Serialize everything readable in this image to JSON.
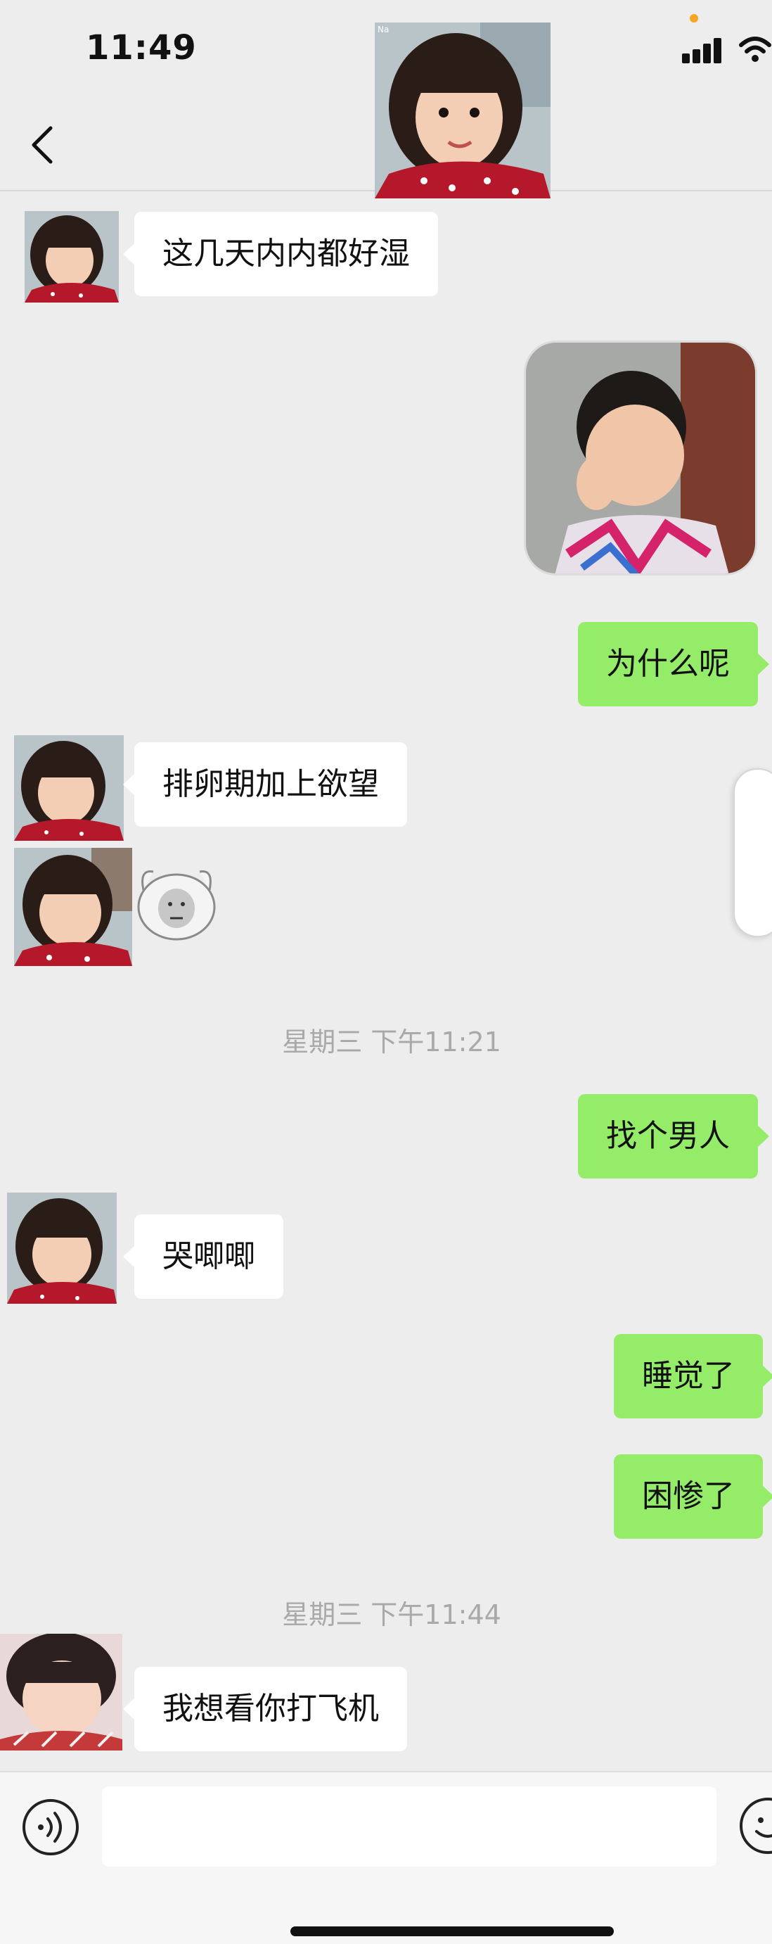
{
  "status_bar": {
    "time": "11:49",
    "signal_icon": "cellular-signal-icon",
    "wifi_icon": "wifi-icon"
  },
  "header": {
    "back_icon": "chevron-left-icon",
    "avatar_overlay_text": "Na"
  },
  "messages": [
    {
      "side": "in",
      "text": "这几天内内都好湿"
    },
    {
      "side": "out",
      "type": "image",
      "description_icon": "photo-message"
    },
    {
      "side": "out",
      "text": "为什么呢"
    },
    {
      "side": "in",
      "text": "排卵期加上欲望"
    },
    {
      "side": "in",
      "type": "sticker",
      "sticker_icon": "panda-face-sticker"
    },
    {
      "side": "out",
      "text": "找个男人"
    },
    {
      "side": "in",
      "text": "哭唧唧"
    },
    {
      "side": "out",
      "text": "睡觉了"
    },
    {
      "side": "out",
      "text": "困惨了"
    },
    {
      "side": "in",
      "text": "我想看你打飞机"
    }
  ],
  "timestamps": [
    "星期三 下午11:21",
    "星期三 下午11:44"
  ],
  "input_bar": {
    "voice_icon": "voice-input-icon",
    "emoji_icon": "emoji-icon",
    "input_value": ""
  },
  "colors": {
    "background": "#ededed",
    "incoming_bubble": "#ffffff",
    "outgoing_bubble": "#95ec69",
    "timestamp_text": "#a9a9a9"
  }
}
